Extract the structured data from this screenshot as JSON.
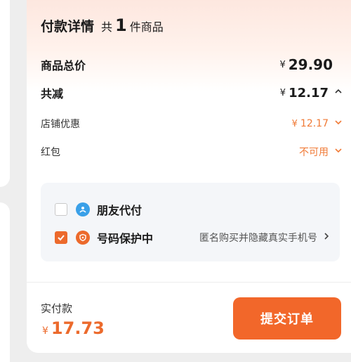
{
  "details": {
    "title": "付款详情",
    "count_prefix": "共",
    "count": "1",
    "count_suffix": "件商品"
  },
  "rows": {
    "total": {
      "label": "商品总价",
      "currency": "¥",
      "amount": "29.90"
    },
    "discount": {
      "label": "共减",
      "currency": "¥",
      "amount": "12.17",
      "chevron": "^"
    },
    "store": {
      "label": "店铺优惠",
      "currency": "¥",
      "amount": "12.17",
      "chevron": "v"
    },
    "redpacket": {
      "label": "红包",
      "value": "不可用",
      "chevron": "v"
    }
  },
  "options": {
    "friend_pay": {
      "label": "朋友代付",
      "checked": false,
      "icon": "friend-pay-icon",
      "icon_color": "#3aa0e8"
    },
    "number_protect": {
      "label": "号码保护中",
      "checked": true,
      "icon": "shield-icon",
      "icon_color": "#ec6a2c",
      "hint": "匿名购买并隐藏真实手机号",
      "chevron": ">"
    }
  },
  "footer": {
    "pay_label": "实付款",
    "currency": "¥",
    "amount": "17.73",
    "submit_label": "提交订单"
  },
  "colors": {
    "accent": "#ec6a2c",
    "button": "#f2672a",
    "option_bg": "#f4f6f9"
  }
}
